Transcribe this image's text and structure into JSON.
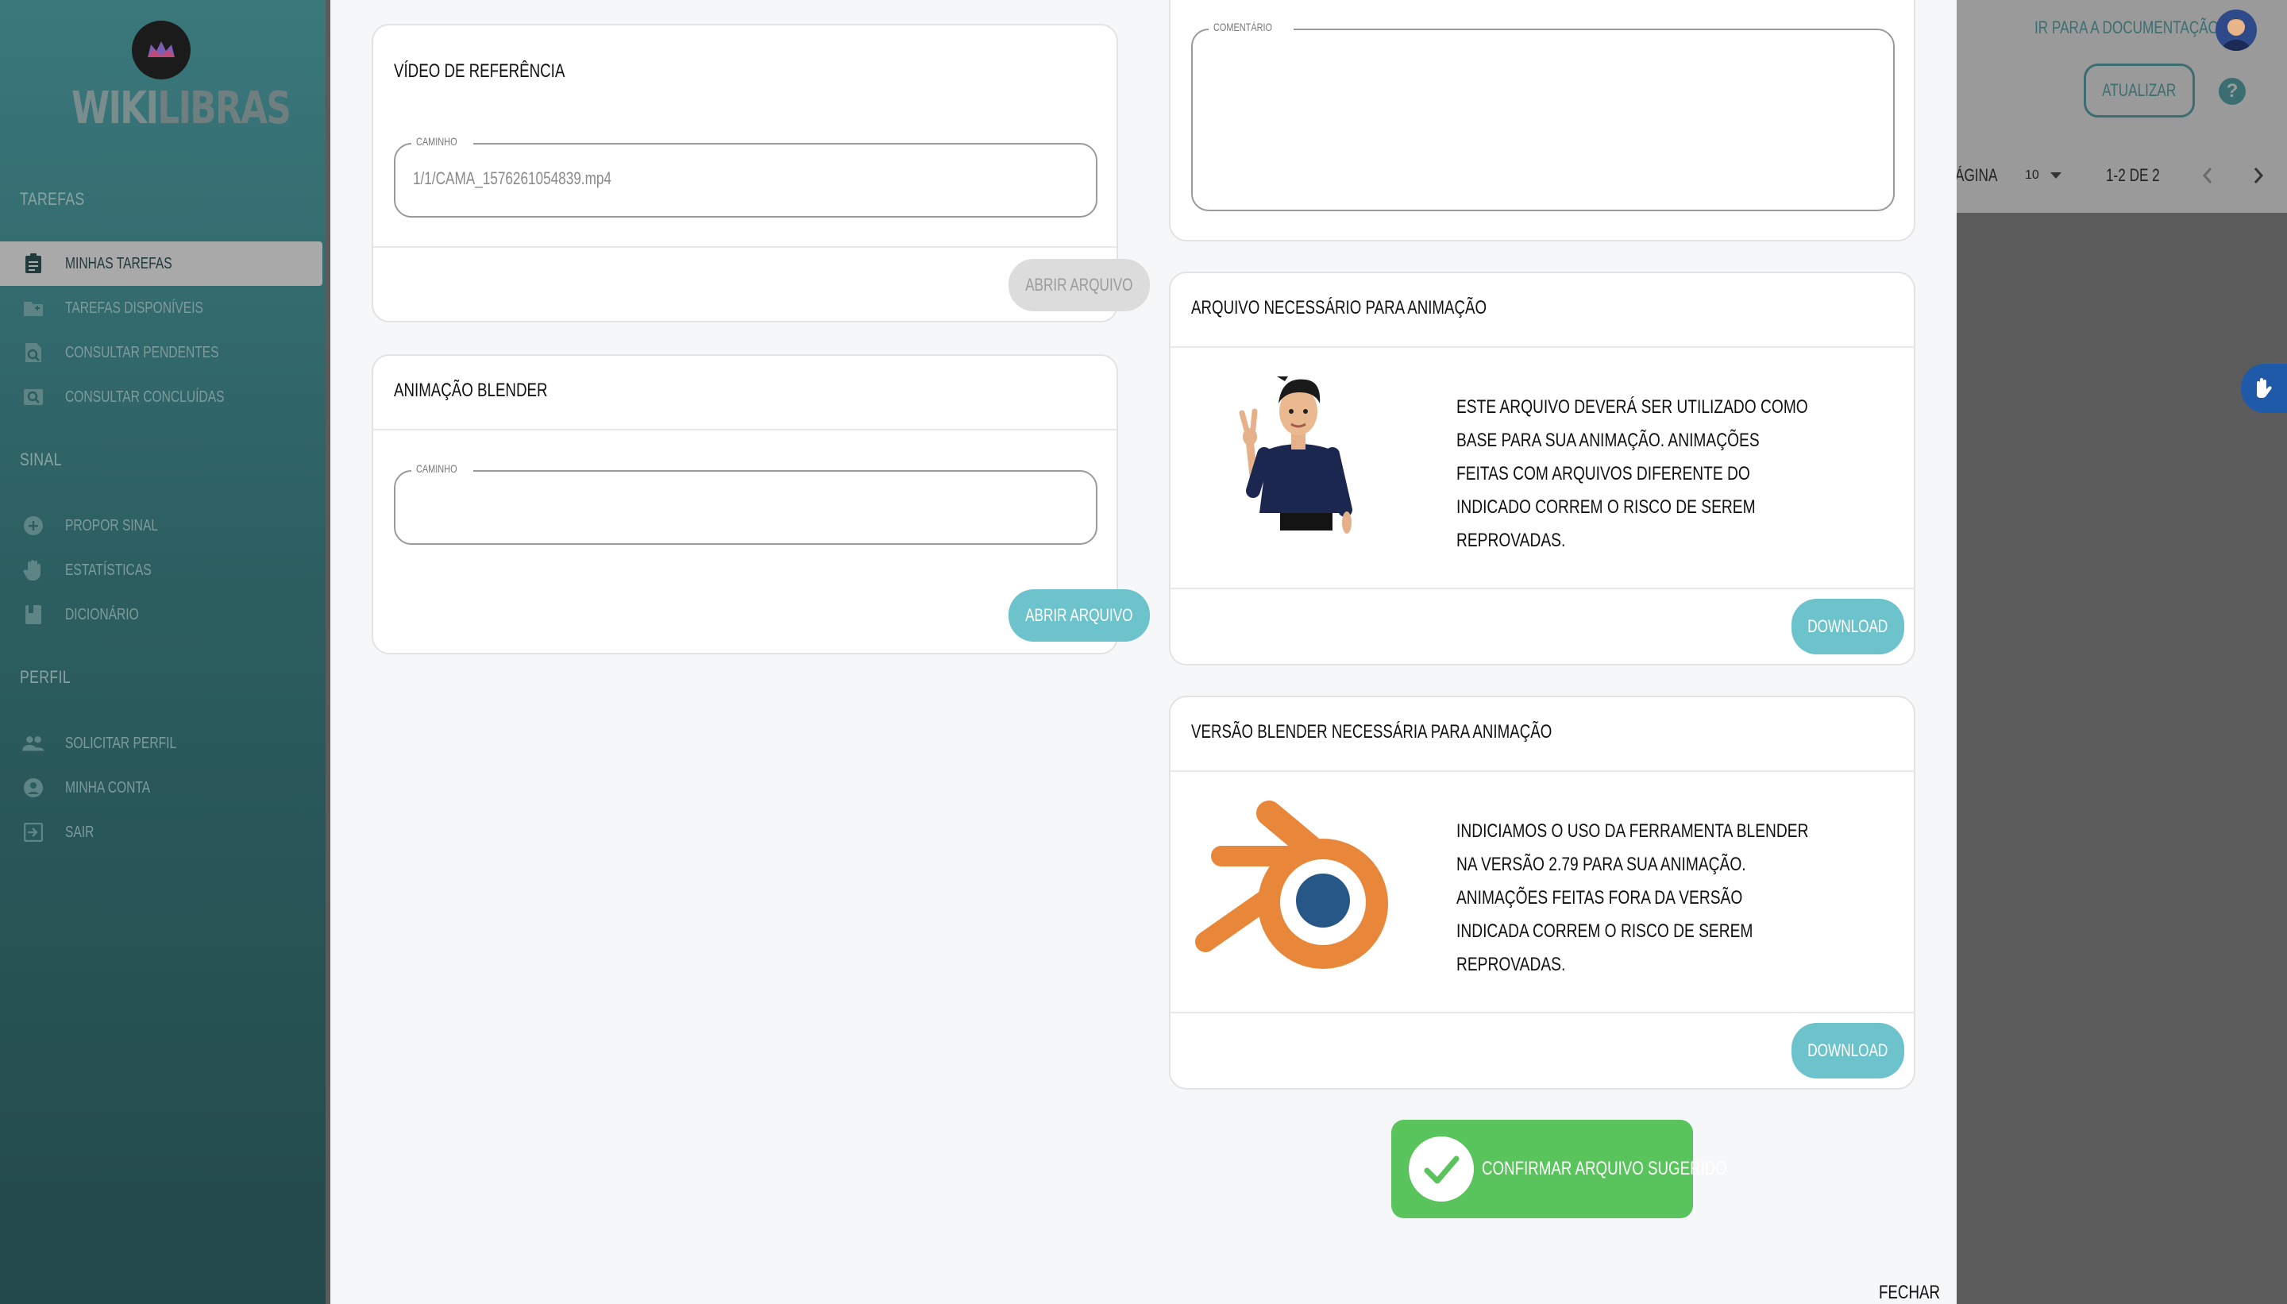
{
  "app": {
    "brand_part1": "WIKI",
    "brand_part2": "LIBRAS"
  },
  "sidebar": {
    "sections": [
      {
        "title": "Tarefas",
        "items": [
          {
            "label": "Minhas tarefas",
            "icon": "clipboard-icon",
            "active": true
          },
          {
            "label": "Tarefas disponíveis",
            "icon": "folder-add-icon",
            "active": false
          },
          {
            "label": "Consultar pendentes",
            "icon": "search-doc-icon",
            "active": false
          },
          {
            "label": "Consultar concluídas",
            "icon": "search-image-icon",
            "active": false
          }
        ]
      },
      {
        "title": "Sinal",
        "items": [
          {
            "label": "Propor sinal",
            "icon": "add-circle-icon",
            "active": false
          },
          {
            "label": "Estatísticas",
            "icon": "hand-icon",
            "active": false
          },
          {
            "label": "Dicionário",
            "icon": "book-icon",
            "active": false
          }
        ]
      },
      {
        "title": "Perfil",
        "items": [
          {
            "label": "Solicitar perfil",
            "icon": "people-icon",
            "active": false
          },
          {
            "label": "Minha conta",
            "icon": "account-circle-icon",
            "active": false
          },
          {
            "label": "Sair",
            "icon": "logout-icon",
            "active": false
          }
        ]
      }
    ]
  },
  "topbar": {
    "doc_link": "Ir para a documentação",
    "refresh_label": "Atualizar",
    "help": "?"
  },
  "pagination": {
    "per_page_label": "ágina",
    "per_page_value": "10",
    "range": "1-2 de 2",
    "prev": "‹",
    "next": "›"
  },
  "dialog": {
    "reference_video": {
      "title": "Vídeo de referência",
      "field_label": "Caminho",
      "field_value": "1/1/CAMA_1576261054839.mp4",
      "button": "Abrir arquivo"
    },
    "blender_animation": {
      "title": "Animação Blender",
      "field_label": "Caminho",
      "field_value": "",
      "button": "Abrir arquivo"
    },
    "comment": {
      "field_label": "Comentário",
      "field_value": ""
    },
    "required_file": {
      "title": "Arquivo necessário para animação",
      "text": "Este arquivo deverá ser utilizado como base para sua animação. Animações feitas com arquivos diferente do indicado correm o risco de serem reprovadas.",
      "button": "Download"
    },
    "blender_version": {
      "title": "Versão Blender necessária para animação",
      "text": "Indiciamos o uso da ferramenta Blender na versão 2.79 para sua animação. Animações feitas fora da versão indicada correm o risco de serem reprovadas.",
      "button": "Download"
    },
    "confirm_button": "Confirmar arquivo sugerido",
    "close_button": "Fechar"
  },
  "colors": {
    "sidebar_top": "#3a787c",
    "sidebar_bottom": "#23494b",
    "teal_button": "#6cc3cb",
    "confirm_green": "#59c35c",
    "blender_orange": "#e8873a",
    "blender_blue": "#265787"
  }
}
